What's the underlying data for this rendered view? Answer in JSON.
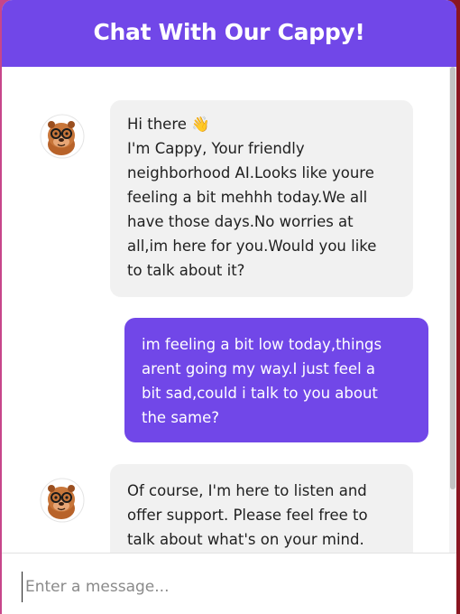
{
  "header": {
    "title": "Chat With Our Cappy!"
  },
  "messages": [
    {
      "role": "bot",
      "lines": [
        "Hi there 👋",
        "I'm Cappy, Your friendly",
        "neighborhood AI.Looks like youre",
        "feeling a bit mehhh today.We all",
        "have those days.No worries at",
        "all,im here for you.Would you like",
        "to talk about it?"
      ]
    },
    {
      "role": "user",
      "lines": [
        "im feeling a bit low today,things",
        "arent going my way.I just feel a",
        "bit sad,could i talk to you about",
        "the same?"
      ]
    },
    {
      "role": "bot",
      "lines": [
        "Of course, I'm here to listen and",
        "offer support. Please feel free to",
        "talk about what's on your mind."
      ]
    }
  ],
  "input": {
    "placeholder": "Enter a message...",
    "value": ""
  },
  "colors": {
    "accent": "#7147e8",
    "bot_bubble": "#f1f1f1"
  },
  "icons": {
    "avatar": "capybara-with-glasses-avatar"
  }
}
